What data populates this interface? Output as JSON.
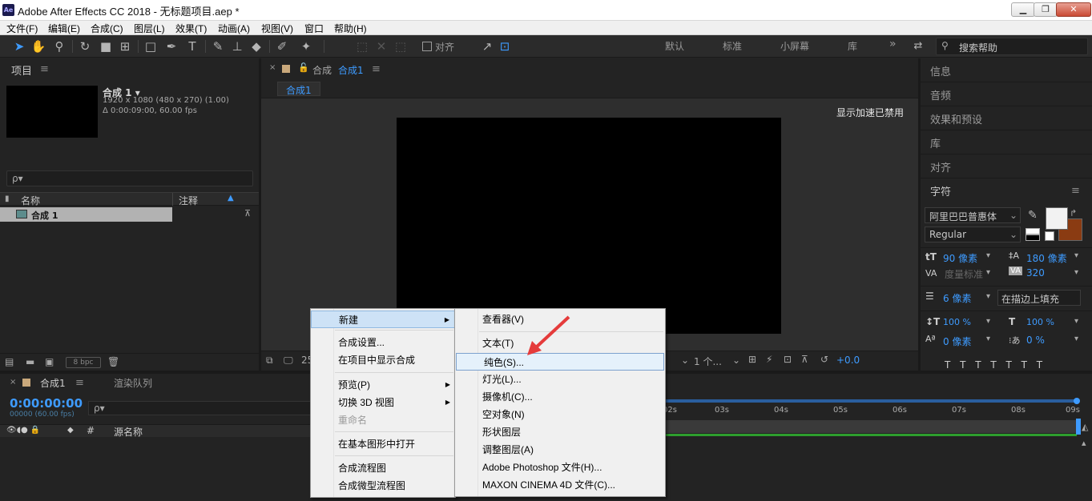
{
  "window": {
    "title": "Adobe After Effects CC 2018 - 无标题项目.aep *",
    "app_icon": "Ae",
    "controls": [
      "minimize",
      "restore",
      "close"
    ]
  },
  "menubar": [
    "文件(F)",
    "编辑(E)",
    "合成(C)",
    "图层(L)",
    "效果(T)",
    "动画(A)",
    "视图(V)",
    "窗口",
    "帮助(H)"
  ],
  "toolbar": {
    "align_label": "对齐",
    "workspaces": [
      "默认",
      "标准",
      "小屏幕",
      "库"
    ],
    "more": "»",
    "search_placeholder": "搜索帮助"
  },
  "project_panel": {
    "title": "项目",
    "comp_name": "合成 1 ▾",
    "comp_res": "1920 x 1080  (480 x 270) (1.00)",
    "comp_dur": "Δ 0:00:09:00, 60.00 fps",
    "search_placeholder": "ρ▾",
    "col_name": "名称",
    "col_comment": "注释",
    "row_name": "合成 1",
    "bpc": "8 bpc"
  },
  "comp_panel": {
    "title_prefix": "合成",
    "title_comp": "合成1",
    "tab": "合成1",
    "accel_notice": "显示加速已禁用",
    "zoom_value": "25",
    "view_value": "1 个...",
    "exposure": "+0.0"
  },
  "right_panels": {
    "items": [
      "信息",
      "音频",
      "效果和预设",
      "库",
      "对齐"
    ],
    "char_title": "字符",
    "font_family": "阿里巴巴普惠体",
    "font_style": "Regular",
    "font_size": "90 像素",
    "leading": "180 像素",
    "kerning": "度量标准",
    "tracking": "320",
    "stroke_width": "6 像素",
    "stroke_mode": "在描边上填充",
    "vscale": "100 %",
    "hscale": "100 %",
    "baseline": "0 像素",
    "tsume": "0 %",
    "fill_color": "#f2f2f2",
    "stroke_color": "#8a3b12"
  },
  "timeline": {
    "tab_comp": "合成1",
    "tab_render": "渲染队列",
    "timecode": "0:00:00:00",
    "timecode_sub": "00000 (60.00 fps)",
    "search_placeholder": "ρ▾",
    "col_hash": "#",
    "col_source": "源名称",
    "ticks": [
      "02s",
      "03s",
      "04s",
      "05s",
      "06s",
      "07s",
      "08s",
      "09s"
    ]
  },
  "context_menu": {
    "items": [
      {
        "label": "新建",
        "submenu": true,
        "highlight": true
      },
      {
        "label": "合成设置..."
      },
      {
        "label": "在项目中显示合成"
      },
      {
        "label": "预览(P)",
        "submenu": true
      },
      {
        "label": "切换 3D 视图",
        "submenu": true
      },
      {
        "label": "重命名",
        "disabled": true
      },
      {
        "label": "在基本图形中打开"
      },
      {
        "label": "合成流程图"
      },
      {
        "label": "合成微型流程图"
      }
    ]
  },
  "submenu": {
    "items": [
      {
        "label": "查看器(V)"
      },
      {
        "label": "文本(T)"
      },
      {
        "label": "纯色(S)...",
        "highlight": true
      },
      {
        "label": "灯光(L)..."
      },
      {
        "label": "摄像机(C)..."
      },
      {
        "label": "空对象(N)"
      },
      {
        "label": "形状图层"
      },
      {
        "label": "调整图层(A)"
      },
      {
        "label": "Adobe Photoshop 文件(H)..."
      },
      {
        "label": "MAXON CINEMA 4D 文件(C)..."
      }
    ]
  },
  "colors": {
    "accent_blue": "#3e9bff",
    "annotation_arrow": "#e53b3b",
    "timeline_green": "#2e9e2e"
  }
}
